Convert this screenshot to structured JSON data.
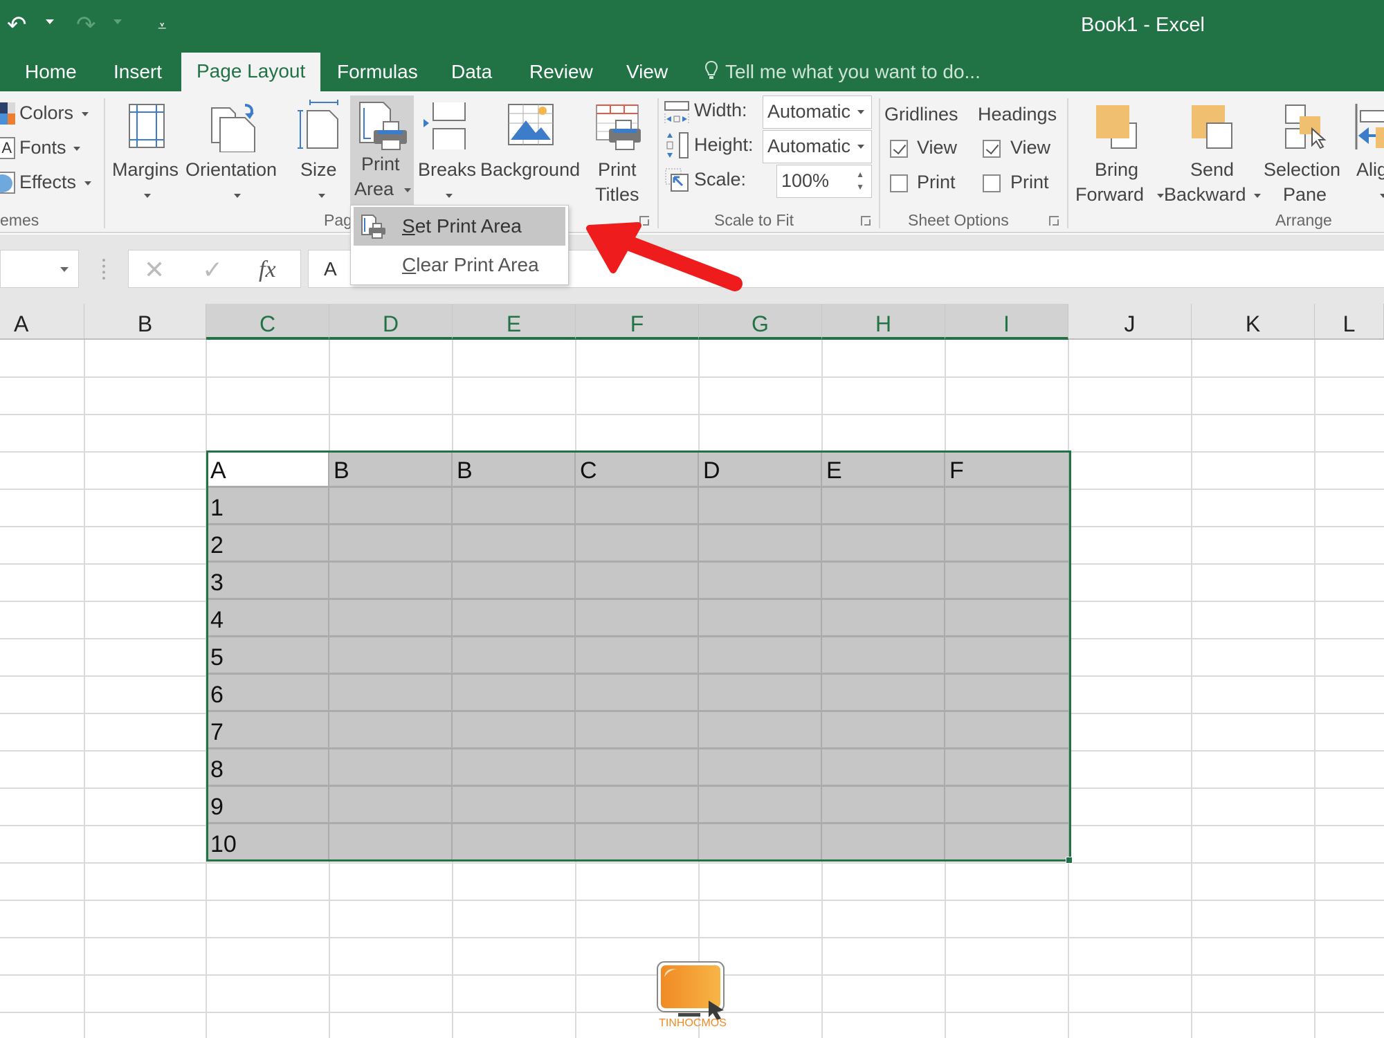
{
  "window": {
    "title": "Book1 - Excel"
  },
  "quick_access": {
    "undo": "undo-icon",
    "redo": "redo-icon",
    "customize": "customize-qat-icon"
  },
  "tabs": [
    {
      "label": "Home",
      "active": false
    },
    {
      "label": "Insert",
      "active": false
    },
    {
      "label": "Page Layout",
      "active": true
    },
    {
      "label": "Formulas",
      "active": false
    },
    {
      "label": "Data",
      "active": false
    },
    {
      "label": "Review",
      "active": false
    },
    {
      "label": "View",
      "active": false
    }
  ],
  "tell_me": {
    "placeholder": "Tell me what you want to do..."
  },
  "ribbon": {
    "themes": {
      "group_label": "emes",
      "colors": "Colors",
      "fonts": "Fonts",
      "effects": "Effects"
    },
    "page_setup": {
      "group_label": "Pag",
      "margins": "Margins",
      "orientation": "Orientation",
      "size": "Size",
      "print_area_line1": "Print",
      "print_area_line2": "Area",
      "breaks": "Breaks",
      "background": "Background",
      "print_titles_line1": "Print",
      "print_titles_line2": "Titles"
    },
    "scale_to_fit": {
      "group_label": "Scale to Fit",
      "width_label": "Width:",
      "width_value": "Automatic",
      "height_label": "Height:",
      "height_value": "Automatic",
      "scale_label": "Scale:",
      "scale_value": "100%"
    },
    "sheet_options": {
      "group_label": "Sheet Options",
      "gridlines": "Gridlines",
      "headings": "Headings",
      "view": "View",
      "print": "Print",
      "gridlines_view": true,
      "gridlines_print": false,
      "headings_view": true,
      "headings_print": false
    },
    "arrange": {
      "group_label": "Arrange",
      "bring_forward_line1": "Bring",
      "bring_forward_line2": "Forward",
      "send_backward_line1": "Send",
      "send_backward_line2": "Backward",
      "selection_pane_line1": "Selection",
      "selection_pane_line2": "Pane",
      "align": "Alig"
    }
  },
  "print_area_menu": {
    "items": [
      {
        "label": "Set Print Area",
        "accel": "S",
        "highlighted": true
      },
      {
        "label": "Clear Print Area",
        "accel": "C",
        "highlighted": false
      }
    ]
  },
  "formula_bar": {
    "name_box": "",
    "cancel": "✕",
    "enter": "✓",
    "fx": "fx",
    "content": "A"
  },
  "columns": [
    {
      "label": "A",
      "selected": false
    },
    {
      "label": "B",
      "selected": false
    },
    {
      "label": "C",
      "selected": true
    },
    {
      "label": "D",
      "selected": true
    },
    {
      "label": "E",
      "selected": true
    },
    {
      "label": "F",
      "selected": true
    },
    {
      "label": "G",
      "selected": true
    },
    {
      "label": "H",
      "selected": true
    },
    {
      "label": "I",
      "selected": true
    },
    {
      "label": "J",
      "selected": false
    },
    {
      "label": "K",
      "selected": false
    },
    {
      "label": "L",
      "selected": false
    }
  ],
  "table": {
    "header": [
      "A",
      "B",
      "B",
      "C",
      "D",
      "E",
      "F"
    ],
    "rows": [
      [
        "1",
        "",
        "",
        "",
        "",
        "",
        ""
      ],
      [
        "2",
        "",
        "",
        "",
        "",
        "",
        ""
      ],
      [
        "3",
        "",
        "",
        "",
        "",
        "",
        ""
      ],
      [
        "4",
        "",
        "",
        "",
        "",
        "",
        ""
      ],
      [
        "5",
        "",
        "",
        "",
        "",
        "",
        ""
      ],
      [
        "6",
        "",
        "",
        "",
        "",
        "",
        ""
      ],
      [
        "7",
        "",
        "",
        "",
        "",
        "",
        ""
      ],
      [
        "8",
        "",
        "",
        "",
        "",
        "",
        ""
      ],
      [
        "9",
        "",
        "",
        "",
        "",
        "",
        ""
      ],
      [
        "10",
        "",
        "",
        "",
        "",
        "",
        ""
      ]
    ]
  },
  "watermark": {
    "text": "TINHOCMOS"
  },
  "colors": {
    "excel_green": "#217346",
    "selection_fill": "#c6c6c6",
    "annotation_red": "#ee1c1c",
    "logo_orange": "#f08a24"
  }
}
